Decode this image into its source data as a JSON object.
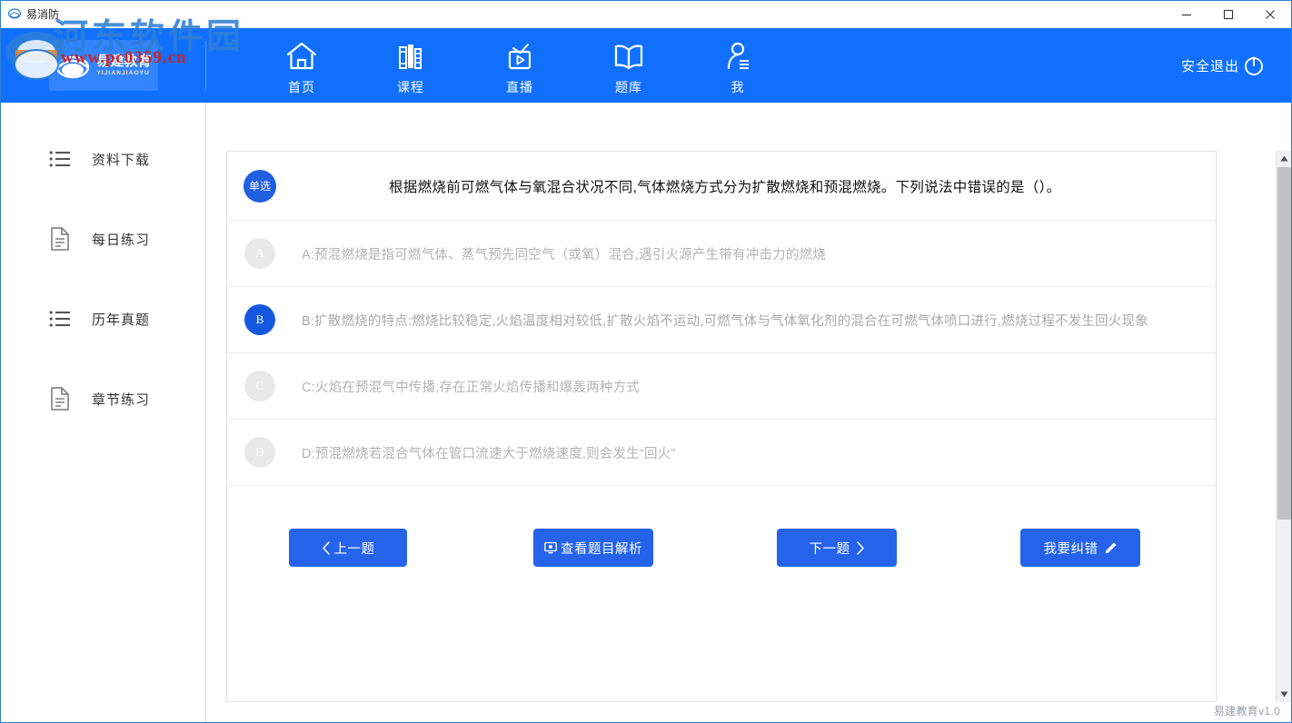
{
  "window": {
    "title": "易消防",
    "app_icon": "app-icon",
    "controls": {
      "minimize": "—",
      "maximize": "▢",
      "close": "✕"
    }
  },
  "brand": {
    "logo_cn": "易建教育",
    "logo_en": "YIJIANJIAOYU",
    "accent_blue": "#1070fd",
    "button_blue": "#2563eb"
  },
  "watermark": {
    "site_name": "河东软件园",
    "url": "www.pc0359.cn"
  },
  "topnav": {
    "items": [
      {
        "label": "首页",
        "icon": "home-icon"
      },
      {
        "label": "课程",
        "icon": "books-icon"
      },
      {
        "label": "直播",
        "icon": "tv-play-icon"
      },
      {
        "label": "题库",
        "icon": "open-book-icon"
      },
      {
        "label": "我",
        "icon": "person-icon"
      }
    ],
    "logout": {
      "label": "安全退出",
      "icon": "power-icon"
    }
  },
  "sidebar": {
    "items": [
      {
        "label": "资料下载",
        "icon": "list-icon"
      },
      {
        "label": "每日练习",
        "icon": "document-icon"
      },
      {
        "label": "历年真题",
        "icon": "list-icon"
      },
      {
        "label": "章节练习",
        "icon": "document-icon"
      }
    ]
  },
  "question": {
    "type_badge": "单选",
    "text": "根据燃烧前可燃气体与氧混合状况不同,气体燃烧方式分为扩散燃烧和预混燃烧。下列说法中错误的是（）。",
    "options": [
      {
        "key": "A",
        "text": "A:预混燃烧是指可燃气体、蒸气预先同空气（或氧）混合,遇引火源产生带有冲击力的燃烧",
        "selected": false
      },
      {
        "key": "B",
        "text": "B:扩散燃烧的特点:燃烧比较稳定,火焰温度相对较低,扩散火焰不运动,可燃气体与气体氧化剂的混合在可燃气体喷口进行,燃烧过程不发生回火现象",
        "selected": true
      },
      {
        "key": "C",
        "text": "C:火焰在预混气中传播,存在正常火焰传播和爆轰两种方式",
        "selected": false
      },
      {
        "key": "D",
        "text": "D:预混燃烧若混合气体在管口流速大于燃烧速度,则会发生“回火”",
        "selected": false
      }
    ]
  },
  "actions": {
    "prev": {
      "label": "上一题",
      "icon": "chevron-left-icon"
    },
    "parse": {
      "label": "查看题目解析",
      "icon": "monitor-icon"
    },
    "next": {
      "label": "下一题",
      "icon": "chevron-right-icon"
    },
    "report_error": {
      "label": "我要纠错",
      "icon": "pencil-icon"
    }
  },
  "scrollbar": {
    "up_arrow": "▲",
    "down_arrow": "▼"
  },
  "footer": {
    "version": "易建教育v1.0"
  }
}
